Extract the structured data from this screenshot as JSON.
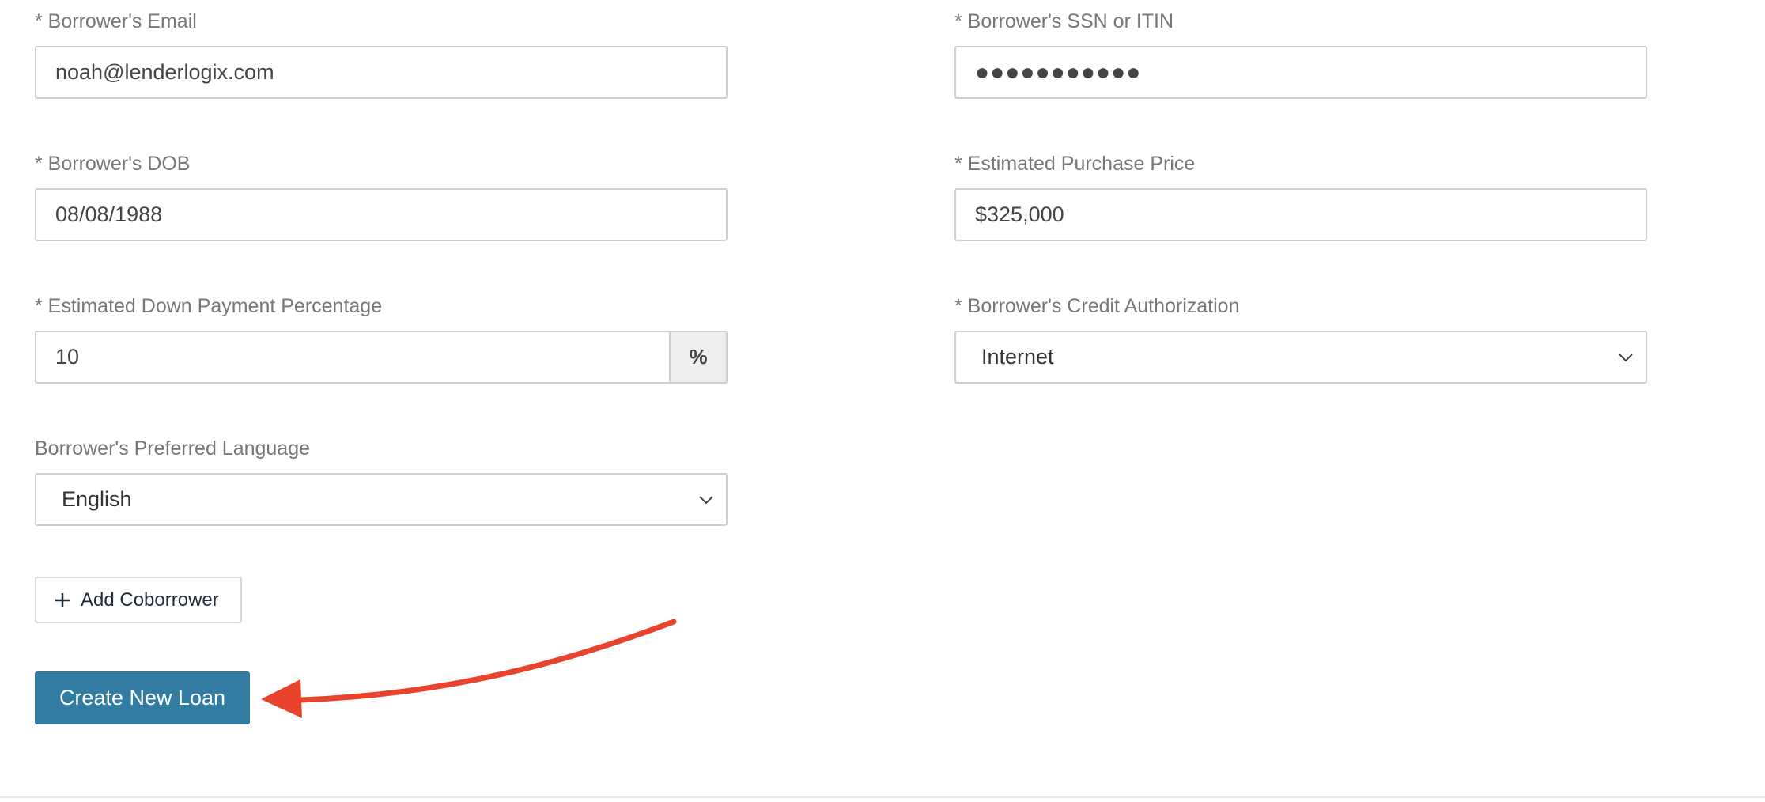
{
  "form": {
    "email": {
      "label": "* Borrower's Email",
      "value": "noah@lenderlogix.com"
    },
    "ssn": {
      "label": "* Borrower's SSN or ITIN",
      "value": "●●●●●●●●●●●"
    },
    "dob": {
      "label": "* Borrower's DOB",
      "value": "08/08/1988"
    },
    "purchase_price": {
      "label": "* Estimated Purchase Price",
      "value": "$325,000"
    },
    "down_payment": {
      "label": "* Estimated Down Payment Percentage",
      "value": "10",
      "addon": "%"
    },
    "credit_auth": {
      "label": "* Borrower's Credit Authorization",
      "value": "Internet"
    },
    "language": {
      "label": "Borrower's Preferred Language",
      "value": "English"
    }
  },
  "actions": {
    "add_coborrower": "Add Coborrower",
    "create_loan": "Create New Loan"
  },
  "colors": {
    "primary": "#327ba1",
    "annotation": "#e8432d"
  }
}
